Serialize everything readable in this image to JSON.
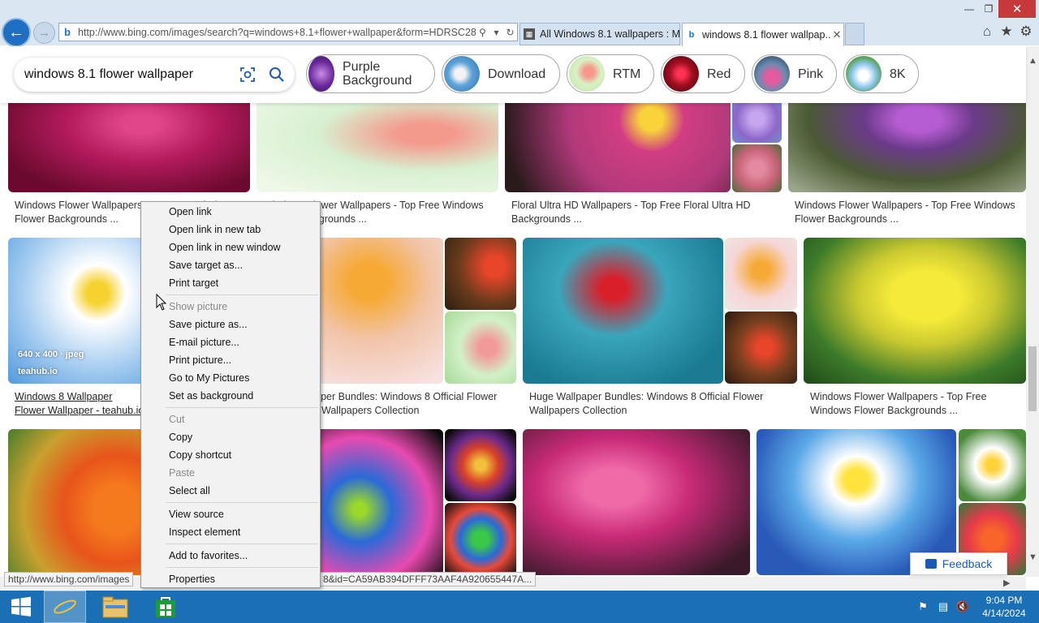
{
  "browser": {
    "address": "http://www.bing.com/images/search?q=windows+8.1+flower+wallpaper&form=HDRSC28",
    "tabs": [
      {
        "label": "All Windows 8.1 wallpapers : M...",
        "active": false
      },
      {
        "label": "windows 8.1 flower wallpap...",
        "active": true
      }
    ]
  },
  "search": {
    "query": "windows 8.1 flower wallpaper",
    "chips": [
      {
        "label": "Purple Background"
      },
      {
        "label": "Download"
      },
      {
        "label": "RTM"
      },
      {
        "label": "Red"
      },
      {
        "label": "Pink"
      },
      {
        "label": "8K"
      }
    ]
  },
  "results": {
    "row1": [
      {
        "caption": "Windows Flower Wallpapers - Top Free Windows Flower Backgrounds ..."
      },
      {
        "caption": "Windows Flower Wallpapers - Top Free Windows Flower Backgrounds ..."
      },
      {
        "caption": "Floral Ultra HD Wallpapers - Top Free Floral Ultra HD Backgrounds ..."
      },
      {
        "caption": "Windows Flower Wallpapers - Top Free Windows Flower Backgrounds ..."
      }
    ],
    "row2": [
      {
        "caption": "Windows 8 Wallpaper Flower Wallpaper - teahub.io",
        "size": "640 x 400 · jpeg",
        "source": "teahub.io"
      },
      {
        "caption": "Huge Wallpaper Bundles: Windows 8 Official Flower Wallpapers Collection"
      },
      {
        "caption": "Huge Wallpaper Bundles: Windows 8 Official Flower Wallpapers Collection"
      },
      {
        "caption": "Windows Flower Wallpapers - Top Free Windows Flower Backgrounds ..."
      }
    ]
  },
  "context_menu": {
    "items": [
      {
        "label": "Open link",
        "disabled": false
      },
      {
        "label": "Open link in new tab",
        "disabled": false
      },
      {
        "label": "Open link in new window",
        "disabled": false
      },
      {
        "label": "Save target as...",
        "disabled": false
      },
      {
        "label": "Print target",
        "disabled": false
      },
      {
        "label": "Show picture",
        "disabled": true
      },
      {
        "label": "Save picture as...",
        "disabled": false
      },
      {
        "label": "E-mail picture...",
        "disabled": false
      },
      {
        "label": "Print picture...",
        "disabled": false
      },
      {
        "label": "Go to My Pictures",
        "disabled": false
      },
      {
        "label": "Set as background",
        "disabled": false
      },
      {
        "label": "Cut",
        "disabled": true
      },
      {
        "label": "Copy",
        "disabled": false
      },
      {
        "label": "Copy shortcut",
        "disabled": false
      },
      {
        "label": "Paste",
        "disabled": true
      },
      {
        "label": "Select all",
        "disabled": false
      },
      {
        "label": "View source",
        "disabled": false
      },
      {
        "label": "Inspect element",
        "disabled": false
      },
      {
        "label": "Add to favorites...",
        "disabled": false
      },
      {
        "label": "Properties",
        "disabled": false
      }
    ]
  },
  "status": {
    "url_left": "http://www.bing.com/images",
    "url_right": "8&id=CA59AB394DFFF73AAF4A920655447A..."
  },
  "feedback": {
    "label": "Feedback"
  },
  "taskbar": {
    "time": "9:04 PM",
    "date": "4/14/2024"
  },
  "colors": {
    "taskbar": "#1b6fb5",
    "ie_blue": "#1c6fc2",
    "close_red": "#c7383b"
  }
}
